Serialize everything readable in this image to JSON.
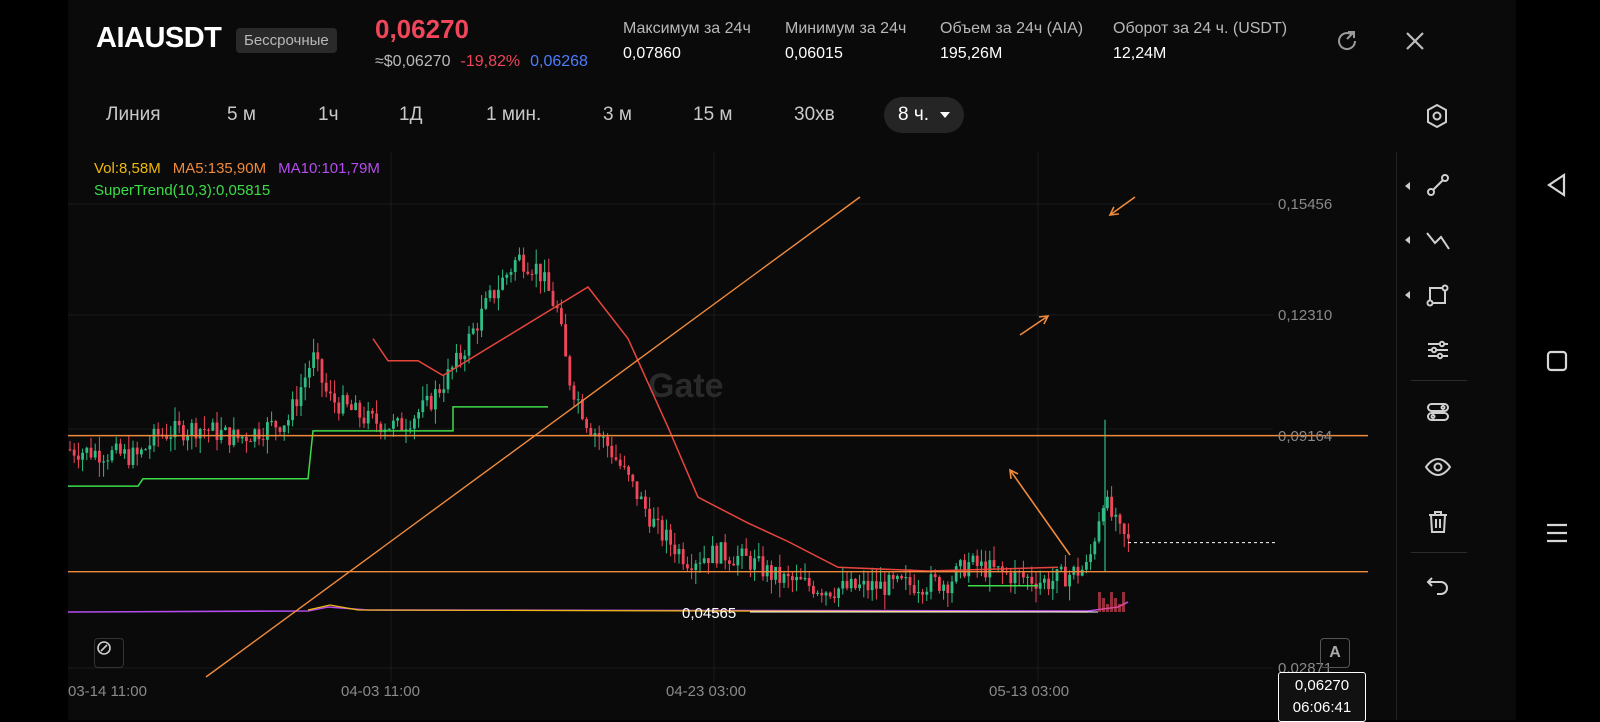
{
  "header": {
    "symbol": "AIAUSDT",
    "badge": "Бессрочные",
    "last_price": "0,06270",
    "usd_price": "≈$0,06270",
    "change": "-19,82%",
    "mark_price": "0,06268",
    "stats": [
      {
        "label": "Максимум за 24ч",
        "value": "0,07860"
      },
      {
        "label": "Минимум за 24ч",
        "value": "0,06015"
      },
      {
        "label": "Объем за 24ч (AIA)",
        "value": "195,26M"
      },
      {
        "label": "Оборот за 24 ч. (USDT)",
        "value": "12,24M"
      }
    ],
    "icons": [
      "share-icon",
      "close-icon"
    ]
  },
  "timeframes": {
    "items": [
      "Линия",
      "5 м",
      "1ч",
      "1Д",
      "1 мин.",
      "3 м",
      "15 м",
      "30хв"
    ],
    "active": "8 ч."
  },
  "legend": {
    "vol": "Vol:8,58M",
    "ma5": "MA5:135,90M",
    "ma10": "MA10:101,79M",
    "supertrend": "SuperTrend(10,3):0,05815"
  },
  "colors": {
    "up": "#2ebd85",
    "down": "#f0465a",
    "supertrend_up": "#3ddc4a",
    "supertrend_down": "#e8453c",
    "drawing": "#f08a3c",
    "ma5": "#f0b90b",
    "ma10": "#b54cf0",
    "vol": "#f0b90b"
  },
  "price_tag": {
    "price": "0,06270",
    "countdown": "06:06:41"
  },
  "watermark": "Gate",
  "chart_data": {
    "type": "candlestick",
    "y_ticks": [
      "0,15456",
      "0,12310",
      "0,09164",
      "0,02871"
    ],
    "x_ticks": [
      "03-14 11:00",
      "04-03 11:00",
      "04-23 03:00",
      "05-13 03:00"
    ],
    "ylim": [
      0.0287,
      0.1545
    ],
    "low_label": "0,04565",
    "horizontal_levels": [
      0.0917,
      0.0548
    ],
    "current_price": 0.0627,
    "supertrend_value": 0.05815,
    "volume": {
      "vol": "8,58M",
      "ma5": "135,90M",
      "ma10": "101,79M"
    }
  },
  "toolbar": {
    "tools": [
      "trendline-icon",
      "zigzag-icon",
      "shape-icon",
      "indicator-settings-icon",
      "layers-icon",
      "visibility-icon",
      "trash-icon",
      "undo-icon"
    ]
  },
  "system_nav": [
    "back-icon",
    "home-icon",
    "menu-icon"
  ],
  "controls": {
    "auto_scale": "A"
  }
}
